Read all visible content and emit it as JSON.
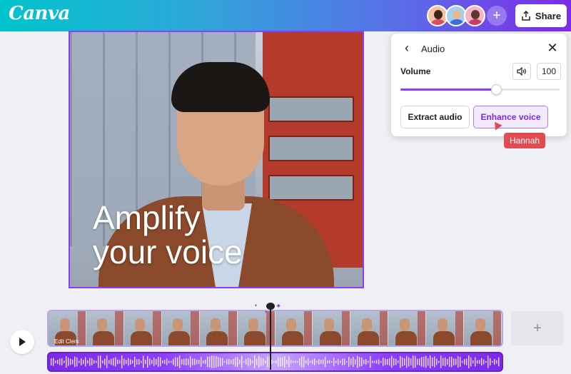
{
  "header": {
    "logo": "Canva",
    "add_collaborator_label": "+",
    "share_label": "Share",
    "accent": "#7d2ae8"
  },
  "collaborators": [
    {
      "name": "avatar-1",
      "head": "#3b2418",
      "body": "#d94c6a",
      "bg": "#f4c2a0"
    },
    {
      "name": "avatar-2",
      "head": "#e8b88c",
      "body": "#3c6fd8",
      "bg": "#9fd0f5"
    },
    {
      "name": "avatar-3",
      "head": "#5a3a2a",
      "body": "#c63b6b",
      "bg": "#f7b3c6"
    }
  ],
  "canvas": {
    "headline": "Amplify\nyour voice"
  },
  "audio_panel": {
    "title": "Audio",
    "volume_label": "Volume",
    "volume_value": "100",
    "slider_fraction": 0.6,
    "extract_label": "Extract audio",
    "enhance_label": "Enhance voice",
    "cursor_user": "Hannah"
  },
  "timeline": {
    "add_track_label": "+",
    "track_name": "Edit Clerk",
    "thumb_count": 12
  }
}
